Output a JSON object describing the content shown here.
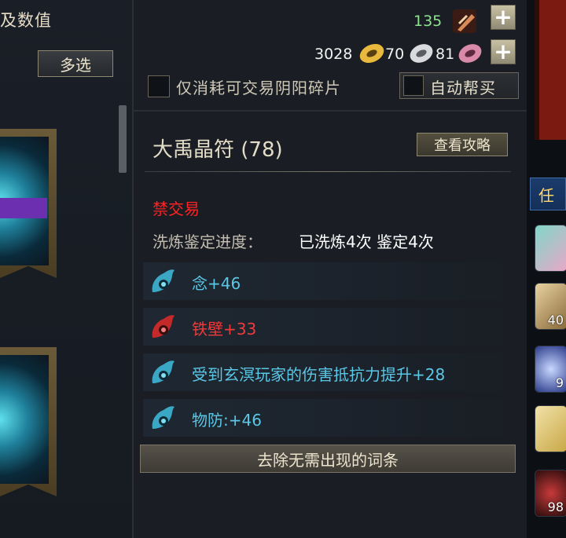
{
  "left_panel": {
    "title": "及数值",
    "multi_select_label": "多选"
  },
  "currencies": {
    "token_count": "135",
    "gold": "3028",
    "silver": "70",
    "jade": "81"
  },
  "options": {
    "only_tradable_label": "仅消耗可交易阴阳碎片",
    "auto_buy_label": "自动帮买"
  },
  "item": {
    "name": "大禹晶符 (78)",
    "guide_button": "查看攻略",
    "trade_status": "禁交易",
    "refine_progress_label": "洗炼鉴定进度：",
    "refine_progress_value": "已洗炼4次  鉴定4次",
    "attributes": [
      {
        "text": "念+46",
        "color": "#5bc7e6",
        "icon": "attribute-scroll-icon"
      },
      {
        "text": "铁壁+33",
        "color": "#ee3a3a",
        "icon": "attribute-scroll-red-icon"
      },
      {
        "text": "受到玄溟玩家的伤害抵抗力提升+28",
        "color": "#5bc7e6",
        "icon": "attribute-scroll-icon"
      },
      {
        "text": "物防:+46",
        "color": "#5bc7e6",
        "icon": "attribute-scroll-icon"
      }
    ],
    "remove_button": "去除无需出现的词条"
  },
  "right_strip": {
    "tab_label": "任",
    "slots": [
      {
        "count": ""
      },
      {
        "count": "40"
      },
      {
        "count": "9"
      },
      {
        "count": ""
      },
      {
        "count": "98"
      }
    ]
  },
  "colors": {
    "token_green": "#8fe28f",
    "trade_red": "#ff2222",
    "attr_cyan": "#5bc7e6",
    "attr_red": "#ee3a3a"
  }
}
